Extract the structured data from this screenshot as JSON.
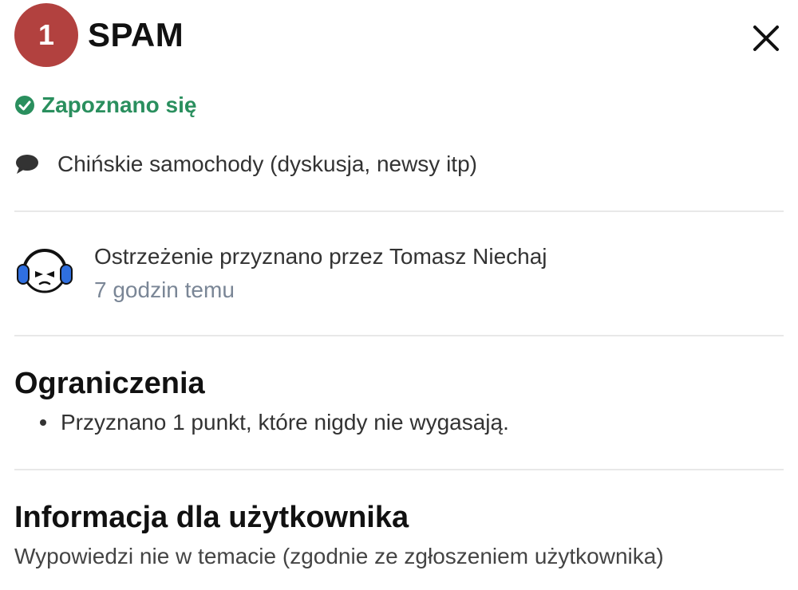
{
  "header": {
    "points": "1",
    "title": "SPAM"
  },
  "status": {
    "acknowledged_label": "Zapoznano się",
    "color": "#2a8f5e"
  },
  "topic": {
    "icon": "speech-bubble-icon",
    "title": "Chińskie samochody (dyskusja, newsy itp)"
  },
  "issuer": {
    "avatar": "headphones-face-avatar",
    "line": "Ostrzeżenie przyznano przez Tomasz Niechaj",
    "time": "7 godzin temu"
  },
  "restrictions": {
    "heading": "Ograniczenia",
    "items": [
      "Przyznano 1 punkt, które nigdy nie wygasają."
    ]
  },
  "user_info": {
    "heading": "Informacja dla użytkownika",
    "message": "Wypowiedzi nie w temacie (zgodnie ze zgłoszeniem użytkownika)"
  },
  "colors": {
    "badge": "#b2413f",
    "muted_text": "#7a8696"
  }
}
